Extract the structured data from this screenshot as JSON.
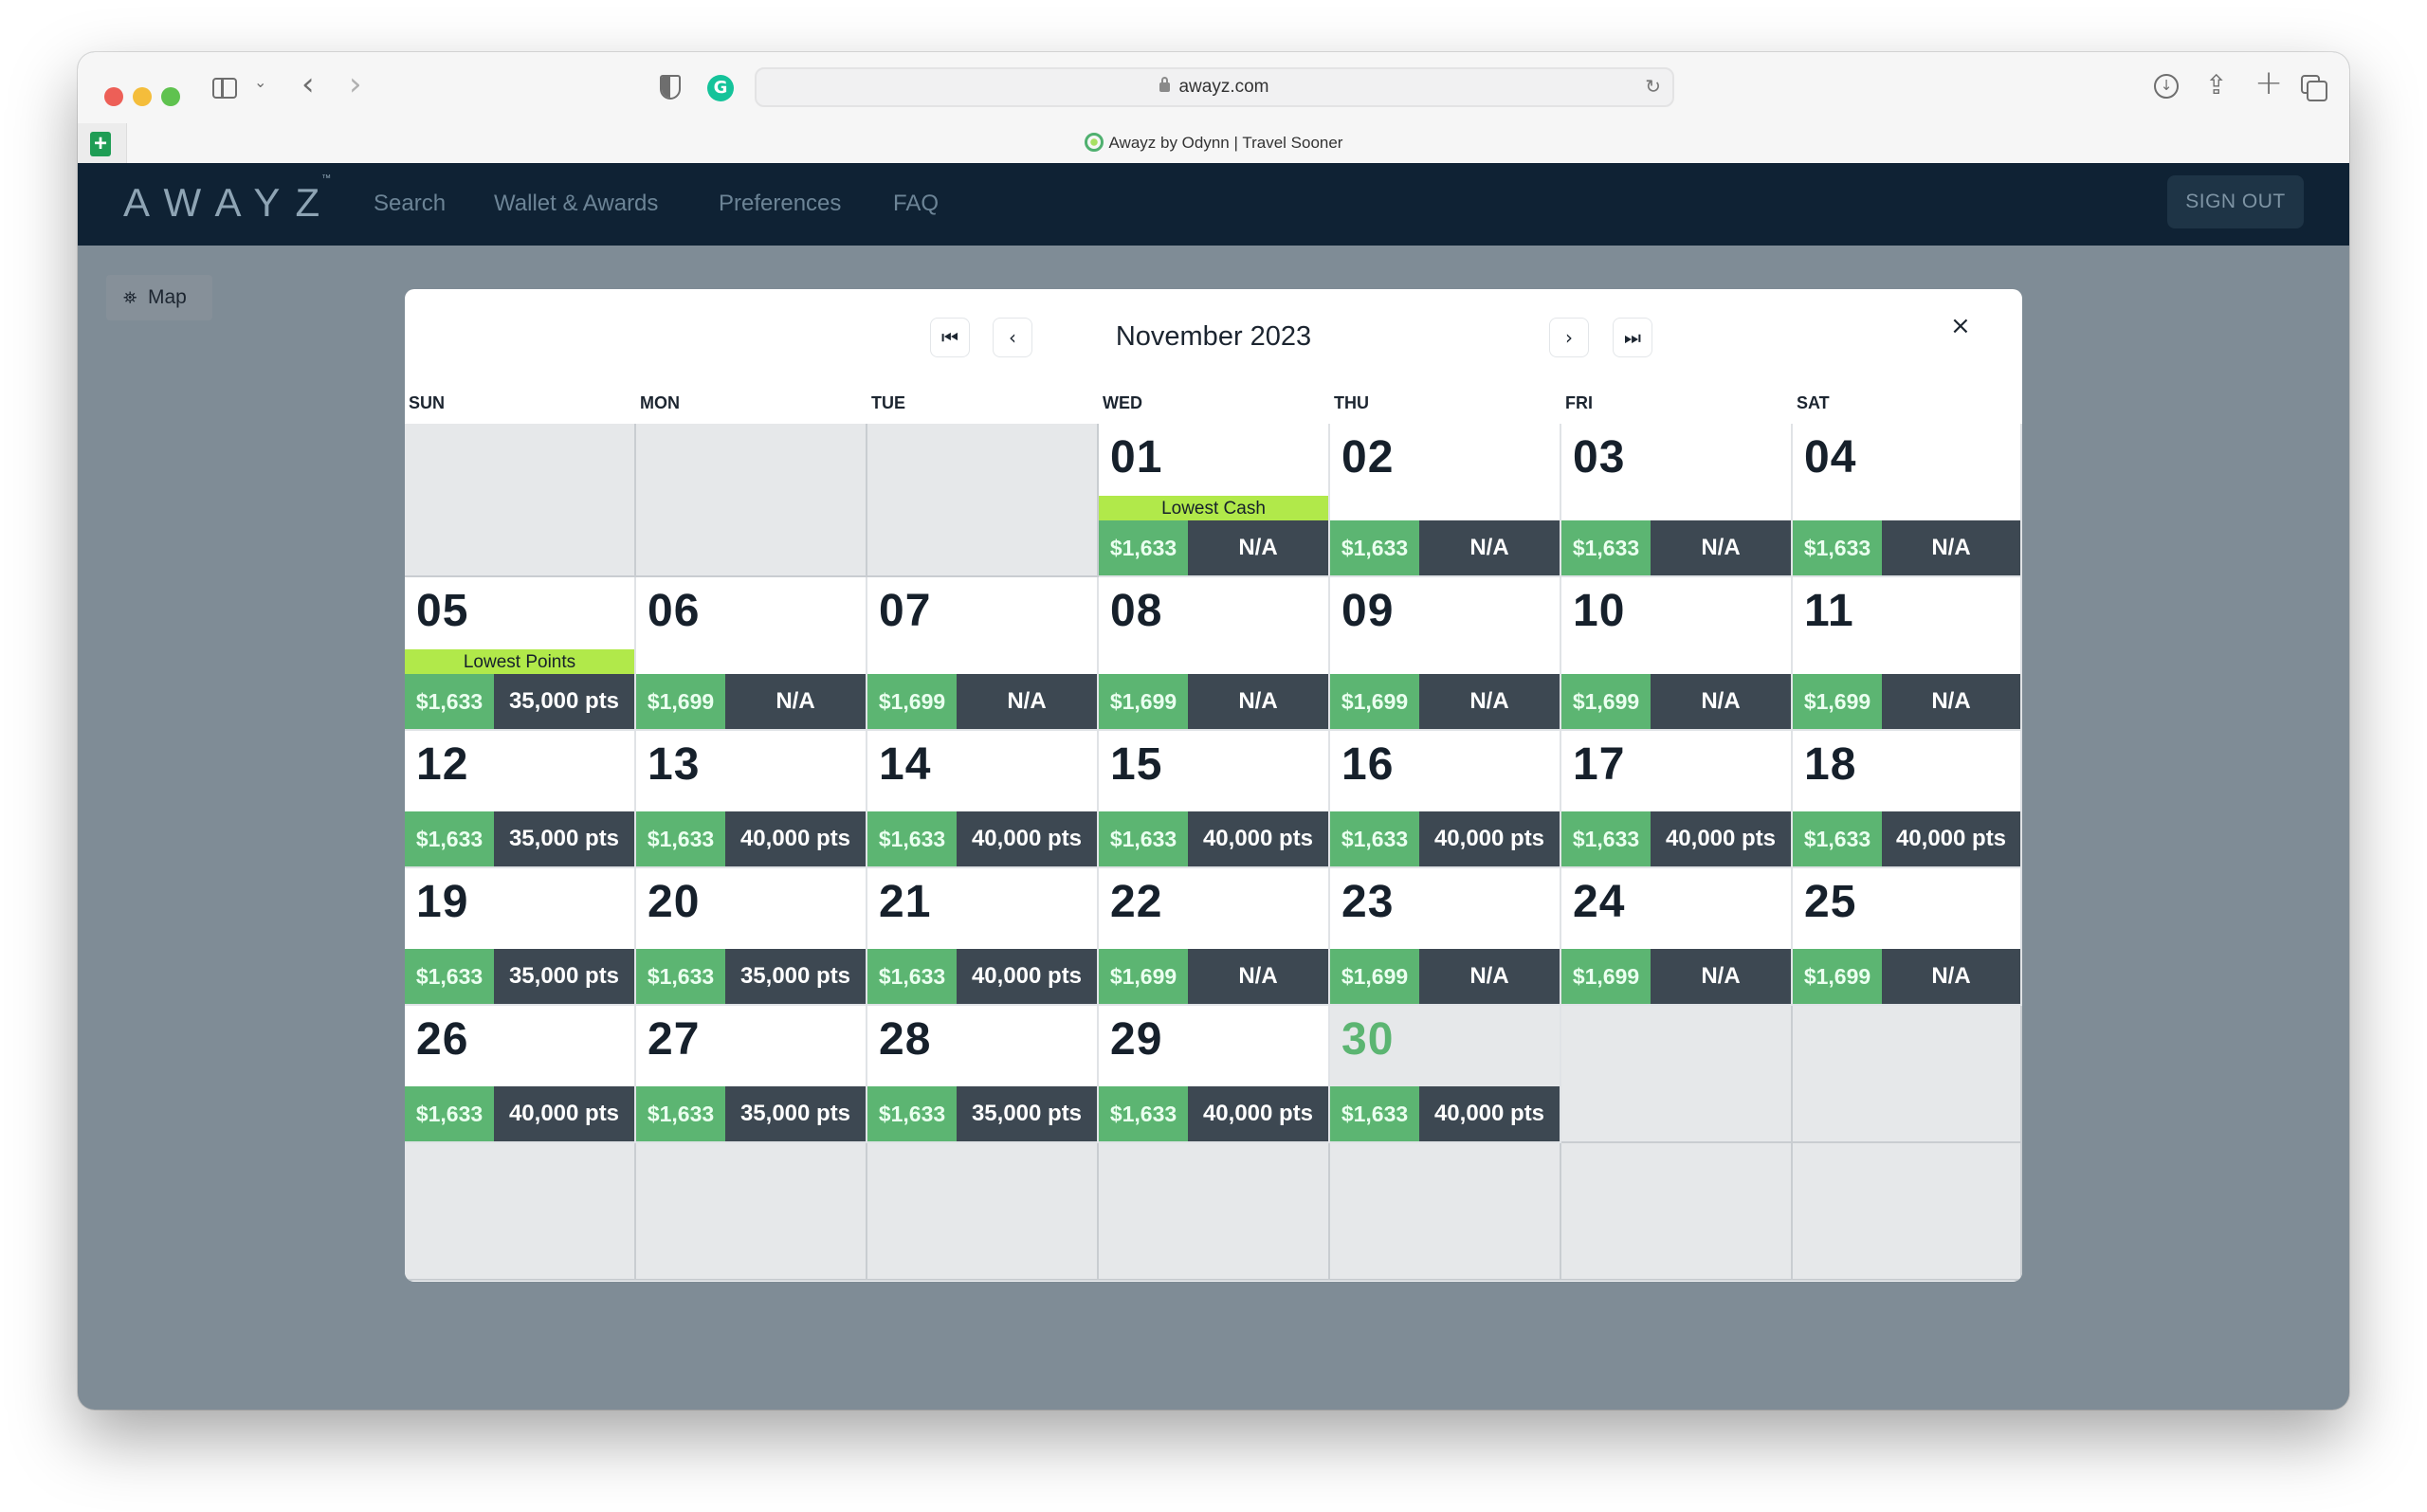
{
  "browser": {
    "url": "awayz.com",
    "tab_title": "Awayz by Odynn | Travel Sooner",
    "icons": [
      "sidebar-icon",
      "chevron-down-icon",
      "back-icon",
      "forward-icon",
      "shield-icon",
      "grammarly-icon",
      "lock-icon",
      "reload-icon",
      "download-icon",
      "share-icon",
      "new-tab-icon",
      "tab-overview-icon",
      "sheets-icon"
    ]
  },
  "nav": {
    "logo": "AWAYZ",
    "logo_tm": "™",
    "links": [
      "Search",
      "Wallet & Awards",
      "Preferences",
      "FAQ"
    ],
    "sign_out": "SIGN OUT"
  },
  "map_button": {
    "label": "Map",
    "icon": "map-icon"
  },
  "calendar": {
    "month_title": "November 2023",
    "nav": {
      "first": "⏮",
      "prev": "‹",
      "next": "›",
      "last": "⏭",
      "close": "×"
    },
    "weekdays": [
      "SUN",
      "MON",
      "TUE",
      "WED",
      "THU",
      "FRI",
      "SAT"
    ],
    "leading_empty": 3,
    "trailing_empty_row": true,
    "today": "30",
    "colors": {
      "cash_bg": "#5cb572",
      "points_bg": "#3d4852",
      "badge_bg": "#b1e94a",
      "today_number": "#5cb572"
    },
    "days": [
      {
        "day": "01",
        "cash": "$1,633",
        "points": "N/A",
        "badge": "Lowest Cash"
      },
      {
        "day": "02",
        "cash": "$1,633",
        "points": "N/A"
      },
      {
        "day": "03",
        "cash": "$1,633",
        "points": "N/A"
      },
      {
        "day": "04",
        "cash": "$1,633",
        "points": "N/A"
      },
      {
        "day": "05",
        "cash": "$1,633",
        "points": "35,000 pts",
        "badge": "Lowest Points"
      },
      {
        "day": "06",
        "cash": "$1,699",
        "points": "N/A"
      },
      {
        "day": "07",
        "cash": "$1,699",
        "points": "N/A"
      },
      {
        "day": "08",
        "cash": "$1,699",
        "points": "N/A"
      },
      {
        "day": "09",
        "cash": "$1,699",
        "points": "N/A"
      },
      {
        "day": "10",
        "cash": "$1,699",
        "points": "N/A"
      },
      {
        "day": "11",
        "cash": "$1,699",
        "points": "N/A"
      },
      {
        "day": "12",
        "cash": "$1,633",
        "points": "35,000 pts"
      },
      {
        "day": "13",
        "cash": "$1,633",
        "points": "40,000 pts"
      },
      {
        "day": "14",
        "cash": "$1,633",
        "points": "40,000 pts"
      },
      {
        "day": "15",
        "cash": "$1,633",
        "points": "40,000 pts"
      },
      {
        "day": "16",
        "cash": "$1,633",
        "points": "40,000 pts"
      },
      {
        "day": "17",
        "cash": "$1,633",
        "points": "40,000 pts"
      },
      {
        "day": "18",
        "cash": "$1,633",
        "points": "40,000 pts"
      },
      {
        "day": "19",
        "cash": "$1,633",
        "points": "35,000 pts"
      },
      {
        "day": "20",
        "cash": "$1,633",
        "points": "35,000 pts"
      },
      {
        "day": "21",
        "cash": "$1,633",
        "points": "40,000 pts"
      },
      {
        "day": "22",
        "cash": "$1,699",
        "points": "N/A"
      },
      {
        "day": "23",
        "cash": "$1,699",
        "points": "N/A"
      },
      {
        "day": "24",
        "cash": "$1,699",
        "points": "N/A"
      },
      {
        "day": "25",
        "cash": "$1,699",
        "points": "N/A"
      },
      {
        "day": "26",
        "cash": "$1,633",
        "points": "40,000 pts"
      },
      {
        "day": "27",
        "cash": "$1,633",
        "points": "35,000 pts"
      },
      {
        "day": "28",
        "cash": "$1,633",
        "points": "35,000 pts"
      },
      {
        "day": "29",
        "cash": "$1,633",
        "points": "40,000 pts"
      },
      {
        "day": "30",
        "cash": "$1,633",
        "points": "40,000 pts"
      }
    ]
  }
}
